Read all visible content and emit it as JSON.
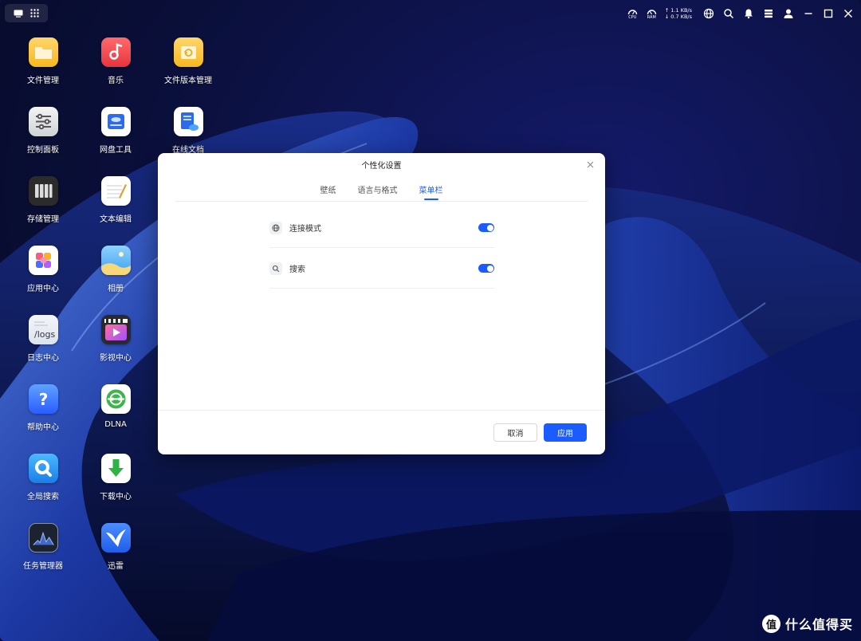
{
  "topbar": {
    "cpu_label": "CPU",
    "ram_label": "RAM",
    "net_up": "↑ 1.1 KB/s",
    "net_down": "↓ 0.7 KB/s"
  },
  "desktop": {
    "apps": [
      {
        "label": "文件管理",
        "icon": "folder-icon"
      },
      {
        "label": "音乐",
        "icon": "music-icon"
      },
      {
        "label": "文件版本管理",
        "icon": "file-version-icon"
      },
      {
        "label": "控制面板",
        "icon": "control-panel-icon"
      },
      {
        "label": "网盘工具",
        "icon": "cloud-drive-icon"
      },
      {
        "label": "在线文档",
        "icon": "online-doc-icon"
      },
      {
        "label": "存储管理",
        "icon": "storage-icon"
      },
      {
        "label": "文本编辑",
        "icon": "text-editor-icon"
      },
      {
        "label": "应用中心",
        "icon": "app-center-icon"
      },
      {
        "label": "相册",
        "icon": "photo-album-icon"
      },
      {
        "label": "日志中心",
        "icon": "logs-icon",
        "text": "/logs"
      },
      {
        "label": "影视中心",
        "icon": "video-center-icon"
      },
      {
        "label": "帮助中心",
        "icon": "help-icon",
        "text": "?"
      },
      {
        "label": "DLNA",
        "icon": "dlna-icon"
      },
      {
        "label": "全局搜索",
        "icon": "global-search-icon"
      },
      {
        "label": "下载中心",
        "icon": "download-icon"
      },
      {
        "label": "任务管理器",
        "icon": "task-manager-icon"
      },
      {
        "label": "迅雷",
        "icon": "thunder-icon"
      }
    ]
  },
  "dialog": {
    "title": "个性化设置",
    "tabs": [
      {
        "label": "壁纸",
        "active": false
      },
      {
        "label": "语言与格式",
        "active": false
      },
      {
        "label": "菜单栏",
        "active": true
      }
    ],
    "settings": [
      {
        "label": "连接模式",
        "icon": "globe-icon",
        "enabled": true
      },
      {
        "label": "搜索",
        "icon": "search-icon",
        "enabled": true
      }
    ],
    "cancel_label": "取消",
    "apply_label": "应用"
  },
  "watermark": {
    "logo_text": "值",
    "text": "什么值得买"
  },
  "colors": {
    "accent": "#1a5cff",
    "desktop_bg": "#0a0f3a"
  }
}
